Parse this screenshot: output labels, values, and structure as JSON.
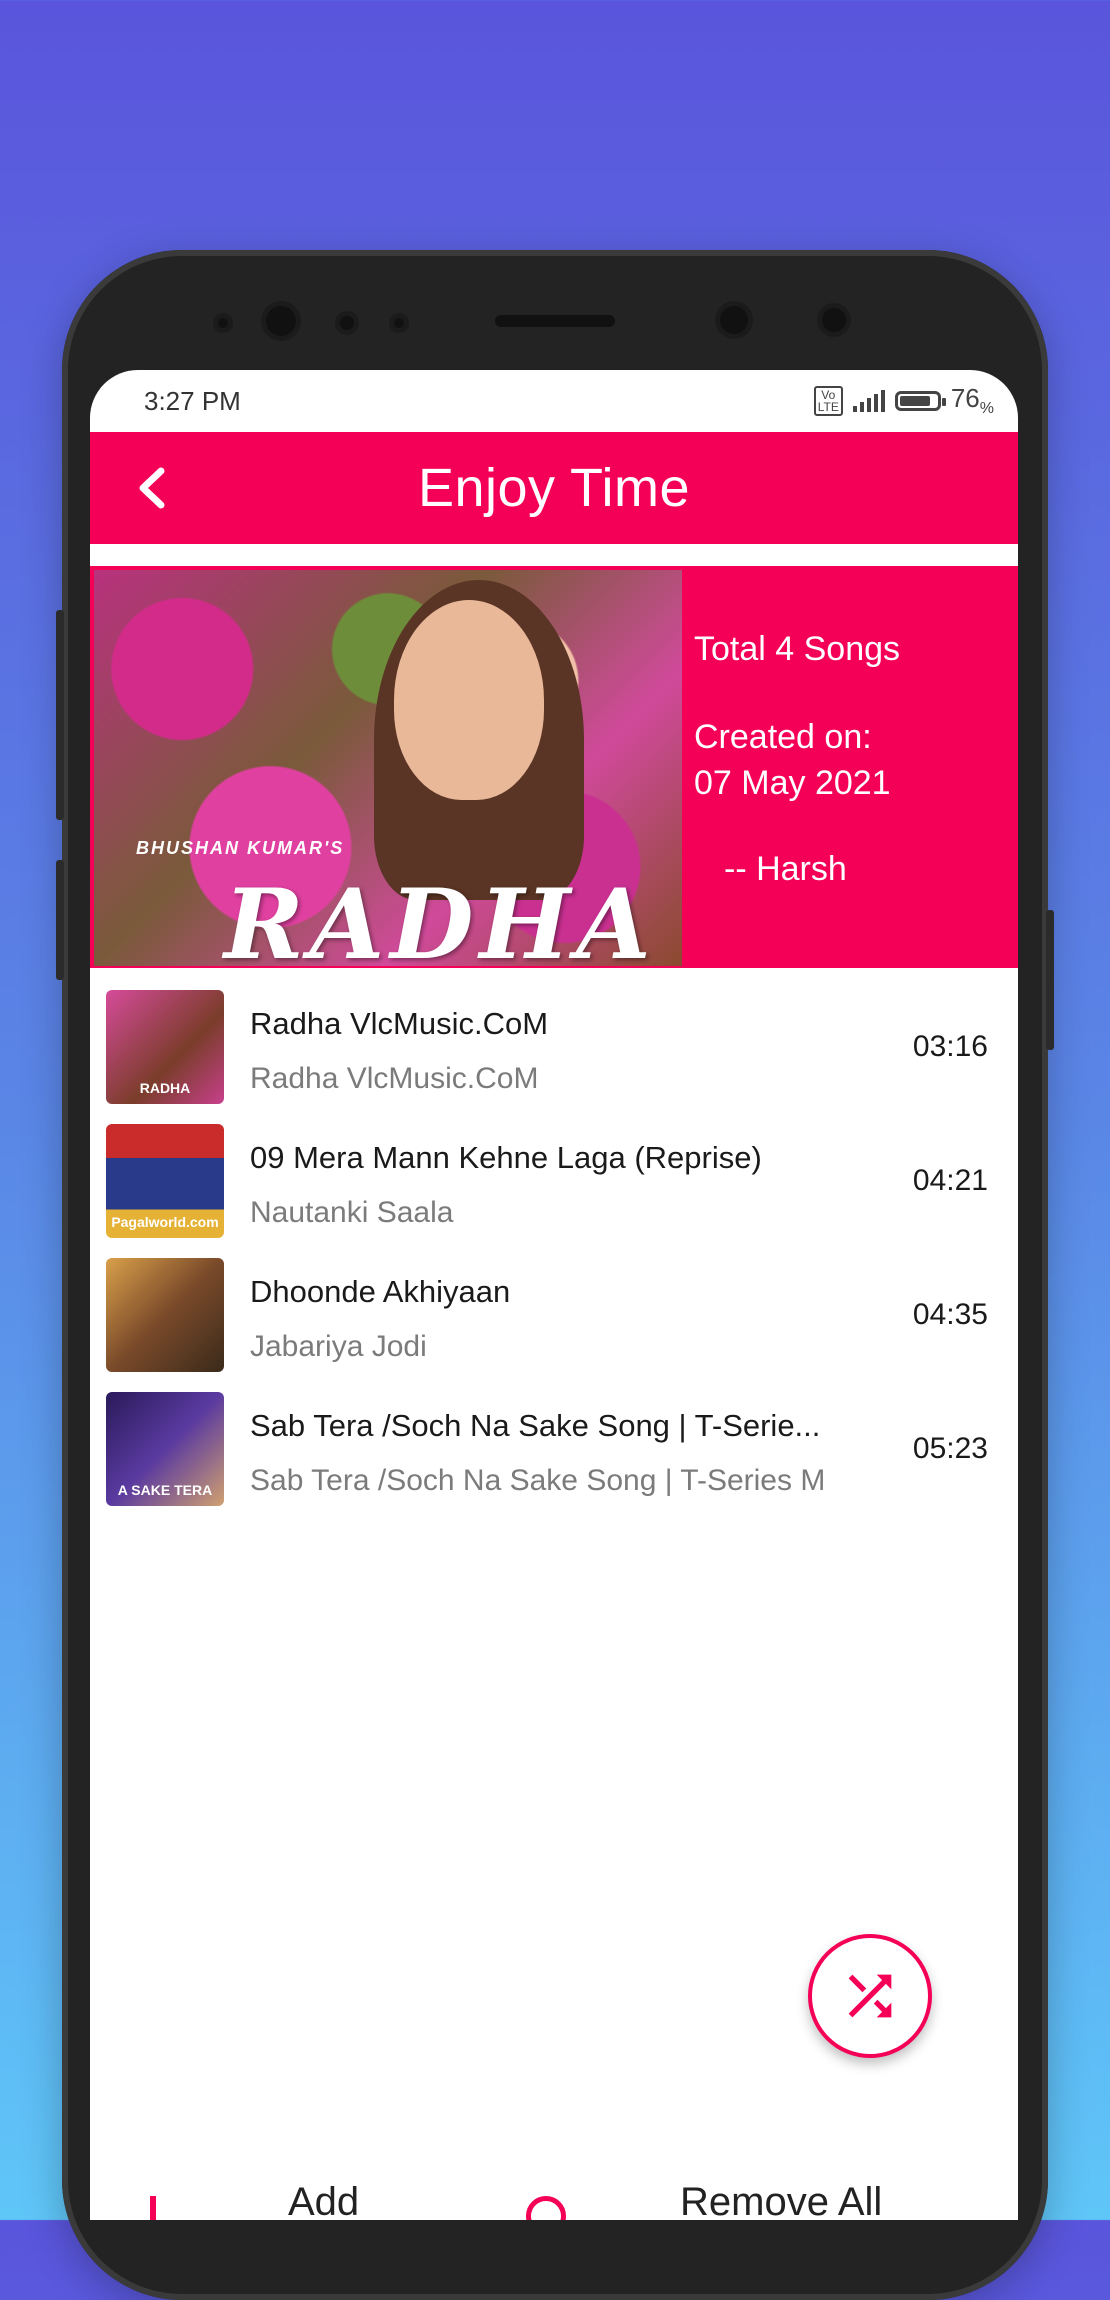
{
  "status_bar": {
    "time": "3:27 PM",
    "network": "Vo\nLTE",
    "battery_percent": "76",
    "battery_unit": "%"
  },
  "app_bar": {
    "title": "Enjoy Time"
  },
  "playlist_info": {
    "total": "Total 4 Songs",
    "created_label": "Created on:",
    "created_date": "07 May 2021",
    "author": "-- Harsh",
    "cover_byline": "BHUSHAN KUMAR'S",
    "cover_logo": "RADHA"
  },
  "songs": [
    {
      "title": "Radha VlcMusic.CoM",
      "artist": "Radha VlcMusic.CoM",
      "duration": "03:16",
      "thumb_label": "RADHA"
    },
    {
      "title": "09 Mera Mann Kehne Laga (Reprise)",
      "artist": "Nautanki Saala",
      "duration": "04:21",
      "thumb_label": "Pagalworld.com"
    },
    {
      "title": "Dhoonde Akhiyaan",
      "artist": "Jabariya Jodi",
      "duration": "04:35",
      "thumb_label": ""
    },
    {
      "title": "Sab Tera /Soch Na Sake Song | T-Serie...",
      "artist": "Sab Tera /Soch Na Sake Song | T-Series M",
      "duration": "05:23",
      "thumb_label": "A SAKE TERA"
    }
  ],
  "bottom_bar": {
    "add_label": "Add",
    "remove_all_label": "Remove All"
  },
  "icons": {
    "back": "arrow-back-icon",
    "shuffle": "shuffle-icon"
  },
  "colors": {
    "accent": "#f50057"
  }
}
